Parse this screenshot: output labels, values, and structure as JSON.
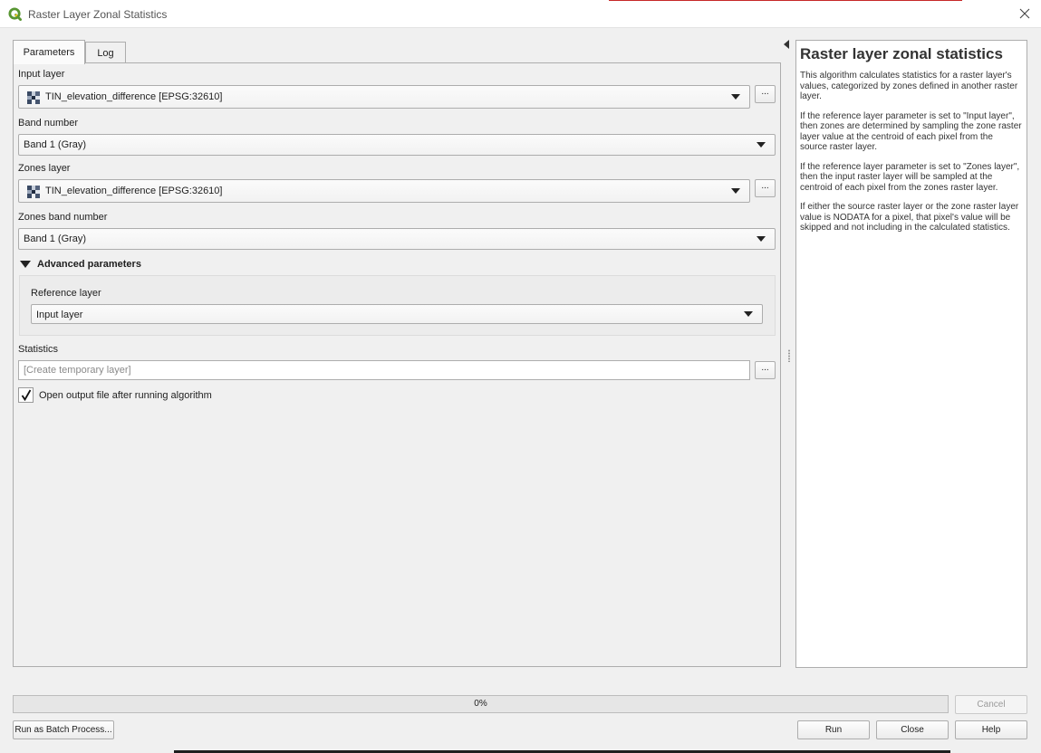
{
  "window": {
    "title": "Raster Layer Zonal Statistics"
  },
  "tabs": [
    {
      "label": "Parameters",
      "active": true
    },
    {
      "label": "Log",
      "active": false
    }
  ],
  "params": {
    "input_layer": {
      "label": "Input layer",
      "value": "TIN_elevation_difference [EPSG:32610]",
      "icon": "raster-layer-icon",
      "browse": "..."
    },
    "band_number": {
      "label": "Band number",
      "value": "Band 1 (Gray)"
    },
    "zones_layer": {
      "label": "Zones layer",
      "value": "TIN_elevation_difference [EPSG:32610]",
      "icon": "raster-layer-icon",
      "browse": "..."
    },
    "zones_band_number": {
      "label": "Zones band number",
      "value": "Band 1 (Gray)"
    },
    "advanced": {
      "label": "Advanced parameters",
      "expanded": true,
      "reference_layer": {
        "label": "Reference layer",
        "value": "Input layer"
      }
    },
    "statistics": {
      "label": "Statistics",
      "placeholder": "[Create temporary layer]",
      "browse": "..."
    },
    "open_output": {
      "label": "Open output file after running algorithm",
      "checked": true
    }
  },
  "help": {
    "title": "Raster layer zonal statistics",
    "paragraphs": [
      "This algorithm calculates statistics for a raster layer's values, categorized by zones defined in another raster layer.",
      "If the reference layer parameter is set to \"Input layer\", then zones are determined by sampling the zone raster layer value at the centroid of each pixel from the source raster layer.",
      "If the reference layer parameter is set to \"Zones layer\", then the input raster layer will be sampled at the centroid of each pixel from the zones raster layer.",
      "If either the source raster layer or the zone raster layer value is NODATA for a pixel, that pixel's value will be skipped and not including in the calculated statistics."
    ]
  },
  "progress": {
    "value": 0,
    "text": "0%",
    "cancel_label": "Cancel"
  },
  "footer": {
    "batch_label": "Run as Batch Process...",
    "run_label": "Run",
    "close_label": "Close",
    "help_label": "Help"
  },
  "colors": {
    "qgis_green": "#589632",
    "qgis_yellow": "#f0c419",
    "progress_fill": "#06b025"
  }
}
